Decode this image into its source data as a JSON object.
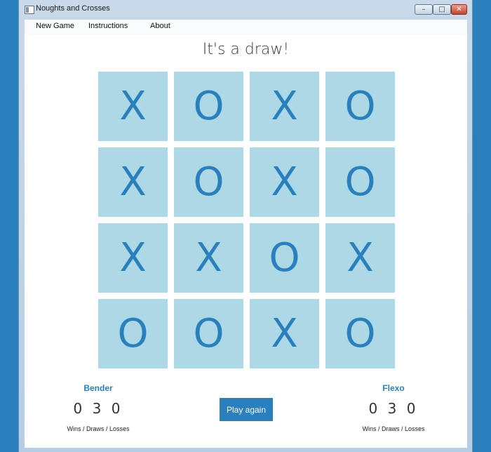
{
  "window": {
    "title": "Noughts and Crosses",
    "buttons": {
      "minimize": "–",
      "maximize": "□",
      "close": "✕"
    }
  },
  "menu": {
    "items": [
      {
        "label": "New Game"
      },
      {
        "label": "Instructions"
      },
      {
        "label": "About"
      }
    ]
  },
  "status": {
    "message": "It's a draw!"
  },
  "board": {
    "rows": 4,
    "cols": 4,
    "cells": [
      [
        "X",
        "O",
        "X",
        "O"
      ],
      [
        "X",
        "O",
        "X",
        "O"
      ],
      [
        "X",
        "X",
        "O",
        "X"
      ],
      [
        "O",
        "O",
        "X",
        "O"
      ]
    ]
  },
  "players": [
    {
      "name": "Bender",
      "score": "0 3 0",
      "caption": "Wins / Draws / Losses"
    },
    {
      "name": "Flexo",
      "score": "0 3 0",
      "caption": "Wins / Draws / Losses"
    }
  ],
  "play_again": {
    "label": "Play again"
  },
  "colors": {
    "accent": "#2a7fbd",
    "cell": "#add8e6",
    "desktop": "#2a7fbd"
  }
}
